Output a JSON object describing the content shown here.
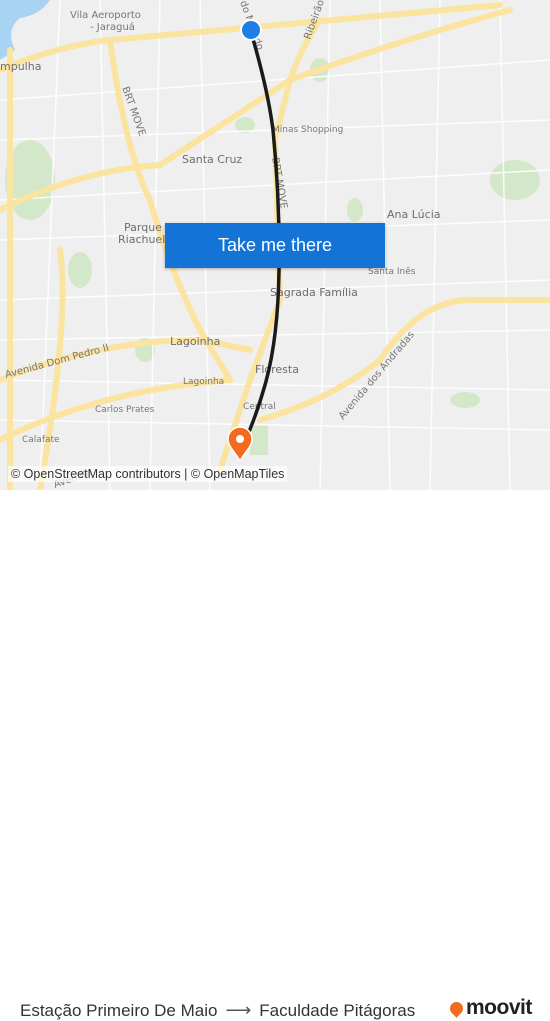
{
  "map": {
    "labels": {
      "vila_aeroporto_1": "Vila Aeroporto",
      "vila_aeroporto_2": "- Jaraguá",
      "pampulha": "mpulha",
      "brt_move_1": "BRT MOVE",
      "brt_move_2": "BRT MOVE",
      "ribeirao": "Ribeirão",
      "top_road": "do Melado",
      "minas_shopping": "Minas Shopping",
      "santa_cruz": "Santa Cruz",
      "parque_riachuelo_1": "Parque",
      "parque_riachuelo_2": "Riachuelo",
      "ana_lucia": "Ana Lúcia",
      "santa_ines": "Santa Inês",
      "sagrada_familia": "Sagrada Família",
      "lagoinha_big": "Lagoinha",
      "lagoinha_small": "Lagoinha",
      "avenida_dom_pedro": "Avenida Dom Pedro II",
      "floresta": "Floresta",
      "carlos_prates": "Carlos Prates",
      "central": "Central",
      "avenida_dos_andradas": "Avenida dos Andradas",
      "calafate": "Calafate",
      "avenida_bottom": "Avenida ..."
    },
    "cta_label": "Take me there",
    "attribution": "© OpenStreetMap contributors | © OpenMapTiles",
    "colors": {
      "route": "#1a1a1a",
      "origin": "#1f7de6",
      "destination": "#f26b21",
      "button": "#1473d6",
      "road": "#fbe7a3",
      "park": "#cfe6c4",
      "water": "#a9d3f2"
    }
  },
  "footer": {
    "origin": "Estação Primeiro De Maio",
    "arrow": "⟶",
    "destination": "Faculdade Pitágoras",
    "brand": "moovit"
  }
}
